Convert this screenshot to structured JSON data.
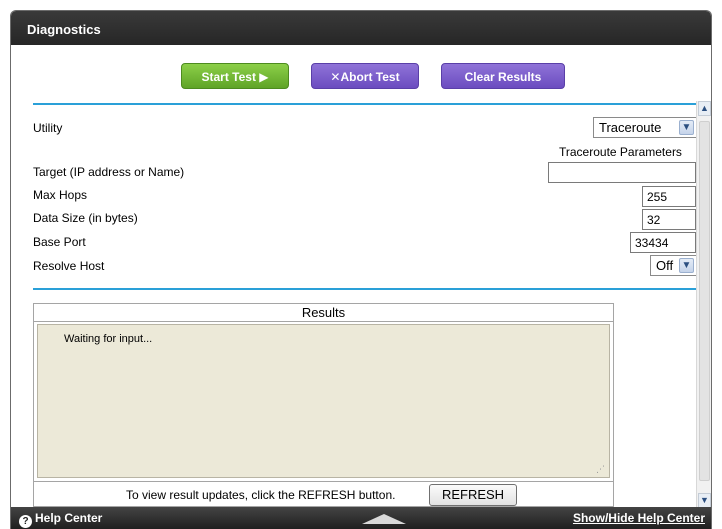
{
  "window": {
    "title": "Diagnostics"
  },
  "toolbar": {
    "start_label": "Start Test ▶",
    "abort_label": "✕Abort Test",
    "clear_label": "Clear Results"
  },
  "form": {
    "utility_label": "Utility",
    "utility_value": "Traceroute",
    "params_heading": "Traceroute Parameters",
    "target_label": "Target (IP address or Name)",
    "target_value": "",
    "maxhops_label": "Max Hops",
    "maxhops_value": "255",
    "datasize_label": "Data Size (in bytes)",
    "datasize_value": "32",
    "baseport_label": "Base Port",
    "baseport_value": "33434",
    "resolve_label": "Resolve Host",
    "resolve_value": "Off"
  },
  "results": {
    "heading": "Results",
    "text": "Waiting for input...",
    "refresh_hint": "To view result updates, click the REFRESH button.",
    "refresh_label": "REFRESH"
  },
  "footer": {
    "help_center": "Help Center",
    "show_hide": "Show/Hide Help Center"
  },
  "colors": {
    "accent_rule": "#2aa0d8",
    "start_button": "#6cb332",
    "purple_button": "#7a5cc9"
  },
  "icons": [
    "help-icon",
    "chevron-down-icon",
    "scroll-up-icon",
    "scroll-down-icon",
    "triangle-up-icon"
  ]
}
